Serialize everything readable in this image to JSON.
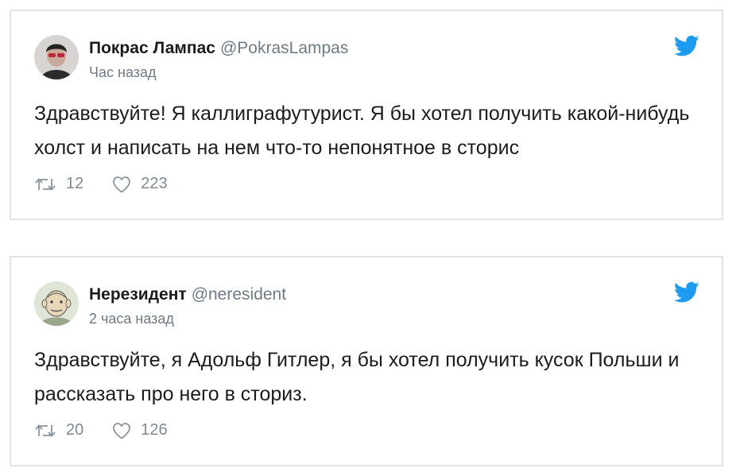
{
  "tweets": [
    {
      "name": "Покрас Лампас",
      "handle": "@PokrasLampas",
      "time": "Час назад",
      "text": "Здравствуйте! Я каллиграфутурист. Я бы хотел получить какой-нибудь холст и написать на нем что-то непонятное в сторис",
      "retweets": "12",
      "likes": "223"
    },
    {
      "name": "Нерезидент",
      "handle": "@neresident",
      "time": "2 часа назад",
      "text": "Здравствуйте, я Адольф Гитлер, я бы хотел получить кусок Польши и рассказать про него в сториз.",
      "retweets": "20",
      "likes": "126"
    }
  ],
  "icons": {
    "brand": "twitter-bird-icon",
    "retweet": "retweet-icon",
    "like": "heart-icon"
  },
  "colors": {
    "twitter_blue": "#1d9bf0",
    "secondary_text": "#6e7a84",
    "border": "#e2e5e8"
  }
}
